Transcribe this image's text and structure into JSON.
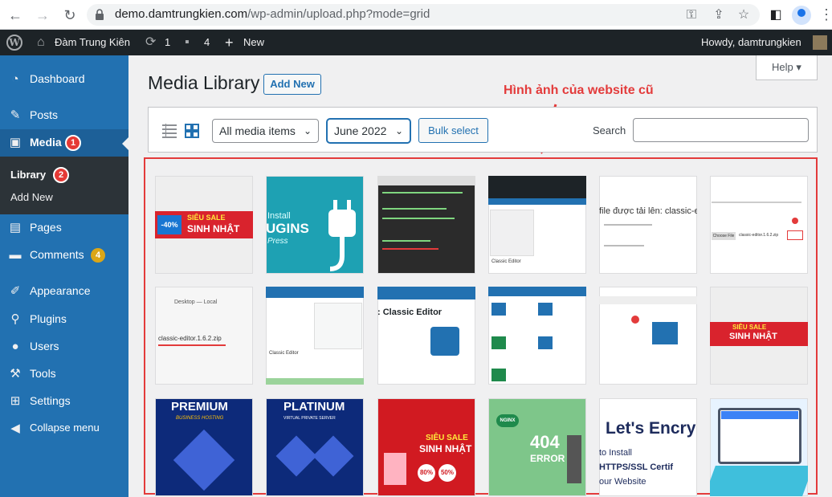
{
  "browser": {
    "url_host": "demo.damtrungkien.com",
    "url_path": "/wp-admin/upload.php?mode=grid"
  },
  "adminbar": {
    "site_name": "Đàm Trung Kiên",
    "updates_count": "1",
    "comments_count": "4",
    "new_label": "New",
    "howdy": "Howdy, damtrungkien"
  },
  "sidebar": {
    "items": [
      {
        "label": "Dashboard",
        "icon": "dashboard-icon"
      },
      {
        "label": "Posts",
        "icon": "pin-icon"
      },
      {
        "label": "Media",
        "icon": "media-icon"
      },
      {
        "label": "Pages",
        "icon": "pages-icon"
      },
      {
        "label": "Comments",
        "icon": "comments-icon"
      },
      {
        "label": "Appearance",
        "icon": "brush-icon"
      },
      {
        "label": "Plugins",
        "icon": "plugin-icon"
      },
      {
        "label": "Users",
        "icon": "users-icon"
      },
      {
        "label": "Tools",
        "icon": "wrench-icon"
      },
      {
        "label": "Settings",
        "icon": "settings-icon"
      },
      {
        "label": "Collapse menu",
        "icon": "collapse-icon"
      }
    ],
    "submenu": {
      "library": "Library",
      "add_new": "Add New"
    },
    "media_badge": "1",
    "library_badge": "2",
    "comments_badge": "4"
  },
  "main": {
    "title": "Media Library",
    "add_new": "Add New",
    "help": "Help",
    "annotation": "Hình ảnh của website cũ",
    "filter_type": "All media items",
    "filter_date": "June 2022",
    "bulk_select": "Bulk select",
    "search_label": "Search"
  },
  "thumbs": {
    "t1": {
      "text1": "SIÊU SALE",
      "text2": "SINH NHẬT",
      "text3": "-40%"
    },
    "t2": {
      "text1": "Install",
      "text2": "UGINS",
      "text3": "Press"
    },
    "t5": {
      "text1": "file được tải lên: classic-editor."
    },
    "t6": {
      "text1": "Choose File",
      "text2": "classic-editor.1.6.2.zip"
    },
    "t7": {
      "text1": "Desktop — Local",
      "text2": "classic-editor.1.6.2.zip"
    },
    "t8": {
      "text1": "Classic Editor"
    },
    "t9": {
      "text1": ": Classic Editor"
    },
    "t12": {
      "text1": "SIÊU SALE",
      "text2": "SINH NHẬT"
    },
    "t13": {
      "text1": "PREMIUM",
      "text2": "BUSINESS HOSTING"
    },
    "t14": {
      "text1": "PLATINUM",
      "text2": "VIRTUAL PRIVATE SERVER"
    },
    "t15": {
      "text1": "SIÊU SALE",
      "text2": "SINH NHẬT",
      "text3": "80%",
      "text4": "50%"
    },
    "t16": {
      "text1": "NGINX",
      "text2": "404",
      "text3": "ERROR"
    },
    "t17": {
      "text1": "Let's Encry",
      "text2": "to Install",
      "text3": "HTTPS/SSL Certif",
      "text4": "our Website"
    }
  },
  "colors": {
    "accent": "#2271b1",
    "adminbar": "#1d2327",
    "annotation": "#e33b3b"
  }
}
